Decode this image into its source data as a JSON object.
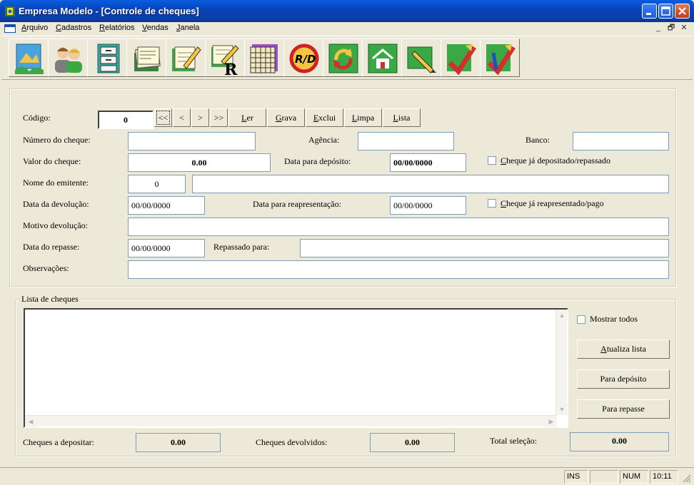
{
  "window": {
    "title": "Empresa Modelo - [Controle de cheques]"
  },
  "menu": [
    "Arquivo",
    "Cadastros",
    "Relatórios",
    "Vendas",
    "Janela"
  ],
  "mdi_controls": [
    "_",
    "🗗",
    "✕"
  ],
  "toolbar": [
    "map-icon",
    "people-icon",
    "file-cabinet-icon",
    "documents-icon",
    "notepad-pencil-icon",
    "notepad-report-icon",
    "calendar-grid-icon",
    "rd-circle-icon",
    "refresh-arrows-icon",
    "home-icon",
    "pen-icon",
    "red-pencil-check-icon",
    "blue-pencil-check-icon"
  ],
  "form": {
    "codigo_label": "Código:",
    "codigo_value": "0",
    "nav": [
      "<<",
      "<",
      ">",
      ">>"
    ],
    "actions": [
      "Ler",
      "Grava",
      "Exclui",
      "Limpa",
      "Lista"
    ],
    "numero_cheque_label": "Número do cheque:",
    "agencia_label": "Agência:",
    "banco_label": "Banco:",
    "valor_label": "Valor do cheque:",
    "valor_value": "0.00",
    "data_deposito_label": "Data para depósito:",
    "data_deposito_value": "00/00/0000",
    "cheque_depositado_label": "Cheque já depositado/repassado",
    "emitente_label": "Nome do emitente:",
    "emitente_code": "0",
    "data_devolucao_label": "Data da devolução:",
    "data_devolucao_value": "00/00/0000",
    "data_reapresentacao_label": "Data para reapresentação:",
    "data_reapresentacao_value": "00/00/0000",
    "cheque_reapresentado_label": "Cheque já reapresentado/pago",
    "motivo_label": "Motivo devolução:",
    "data_repasse_label": "Data do repasse:",
    "data_repasse_value": "00/00/0000",
    "repassado_label": "Repassado para:",
    "observacoes_label": "Observações:"
  },
  "list": {
    "group_label": "Lista de cheques",
    "mostrar_todos_label": "Mostrar todos",
    "atualiza_label": "Atualiza lista",
    "para_deposito_label": "Para depósito",
    "para_repasse_label": "Para repasse",
    "a_depositar_label": "Cheques a depositar:",
    "a_depositar_value": "0.00",
    "devolvidos_label": "Cheques devolvidos:",
    "devolvidos_value": "0.00",
    "total_label": "Total seleção:",
    "total_value": "0.00"
  },
  "status": {
    "ins": "INS",
    "num": "NUM",
    "time": "10:11"
  }
}
